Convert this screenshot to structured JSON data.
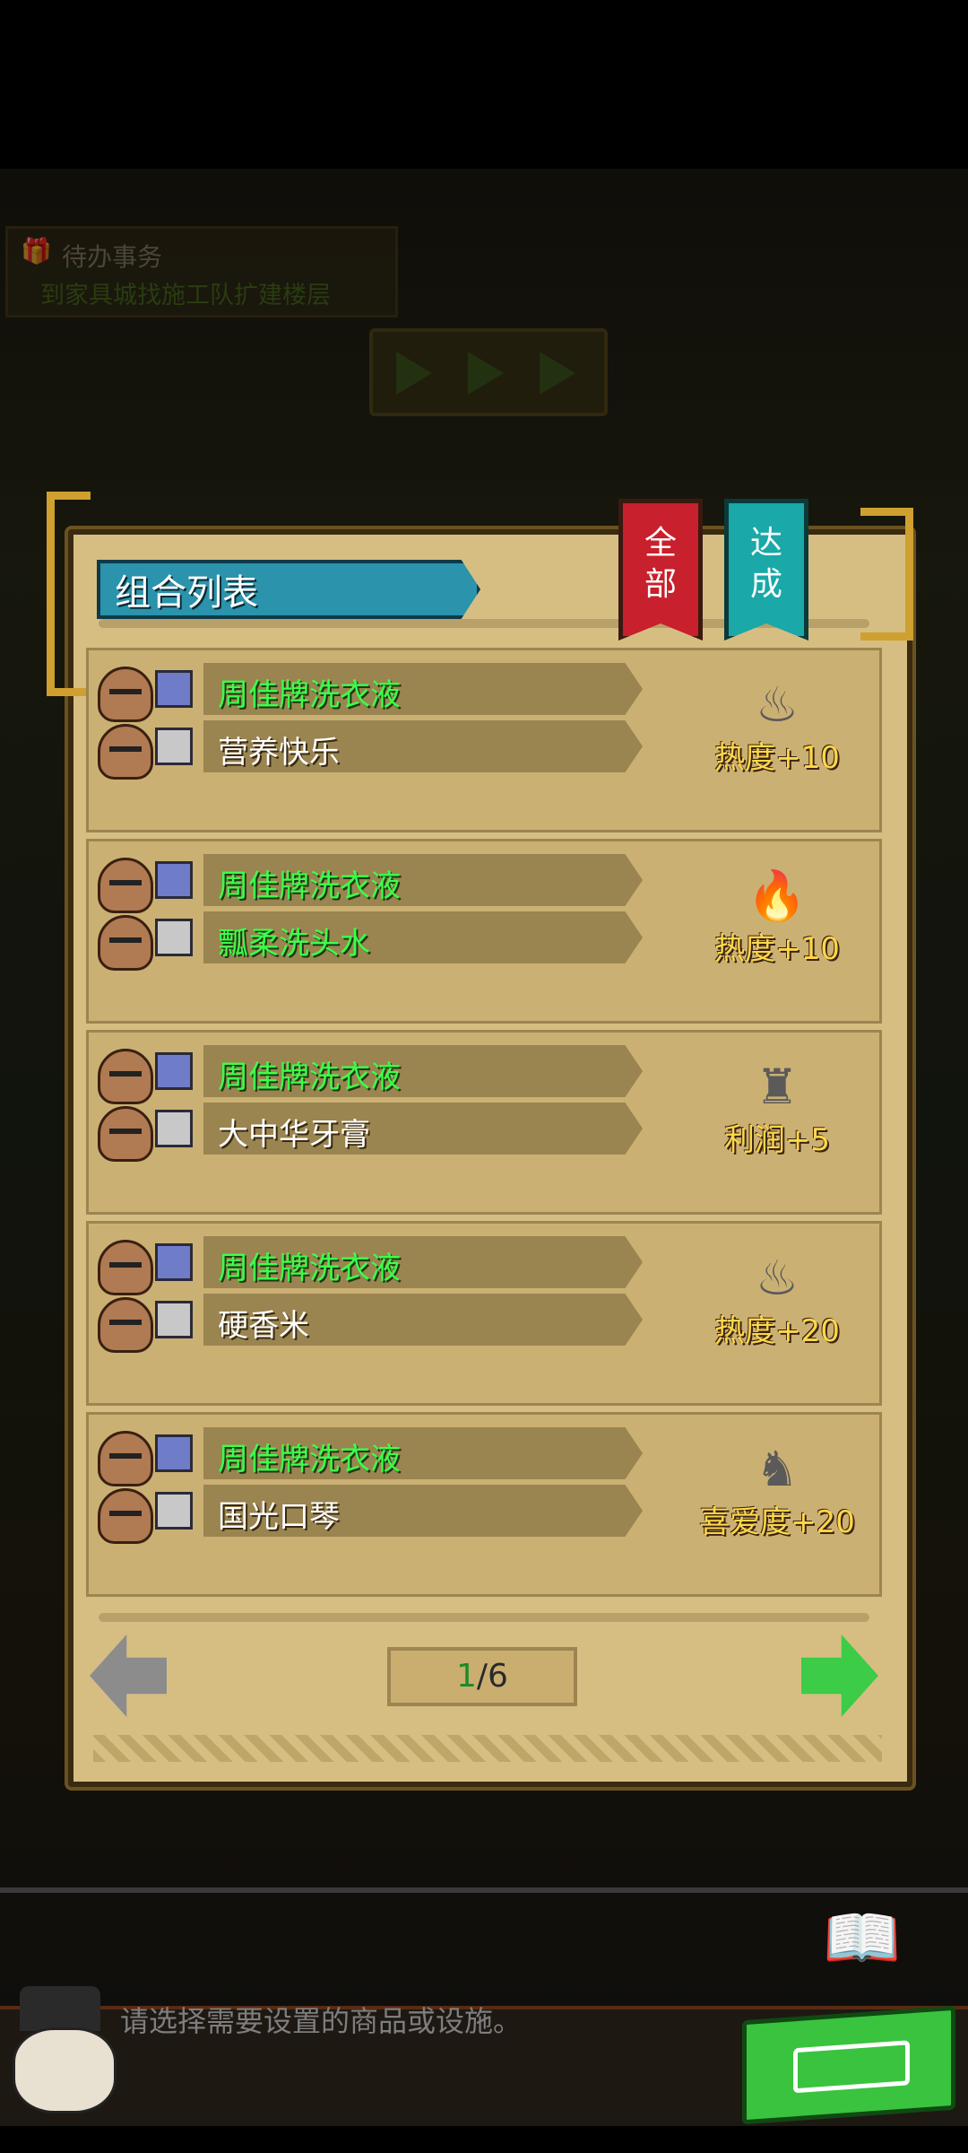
{
  "todo": {
    "title": "待办事务",
    "task": "到家具城找施工队扩建楼层"
  },
  "dialog": {
    "title": "组合列表",
    "tabs": [
      "全\n部",
      "达\n成"
    ],
    "tab_labels": {
      "all": "全部",
      "done": "达成"
    },
    "combos": [
      {
        "item1": "周佳牌洗衣液",
        "item1_color": "green",
        "item2": "营养快乐",
        "item2_color": "white",
        "reward": "热度+10",
        "reward_icon": "heat-icon-inactive"
      },
      {
        "item1": "周佳牌洗衣液",
        "item1_color": "green",
        "item2": "瓢柔洗头水",
        "item2_color": "green",
        "reward": "热度+10",
        "reward_icon": "heat-icon-active"
      },
      {
        "item1": "周佳牌洗衣液",
        "item1_color": "green",
        "item2": "大中华牙膏",
        "item2_color": "white",
        "reward": "利润+5",
        "reward_icon": "profit-icon-inactive"
      },
      {
        "item1": "周佳牌洗衣液",
        "item1_color": "green",
        "item2": "硬香米",
        "item2_color": "white",
        "reward": "热度+20",
        "reward_icon": "heat-icon-inactive"
      },
      {
        "item1": "周佳牌洗衣液",
        "item1_color": "green",
        "item2": "国光口琴",
        "item2_color": "white",
        "reward": "喜爱度+20",
        "reward_icon": "favor-icon-inactive"
      }
    ],
    "pager": {
      "current": "1",
      "total": "/6"
    }
  },
  "hint": "请选择需要设置的商品或设施。",
  "colors": {
    "accent_green": "#3cff4a",
    "reward_gold": "#ffd74a",
    "title_bar": "#2b93ab",
    "tab_all": "#c8202c",
    "tab_done": "#1aa8a8"
  }
}
